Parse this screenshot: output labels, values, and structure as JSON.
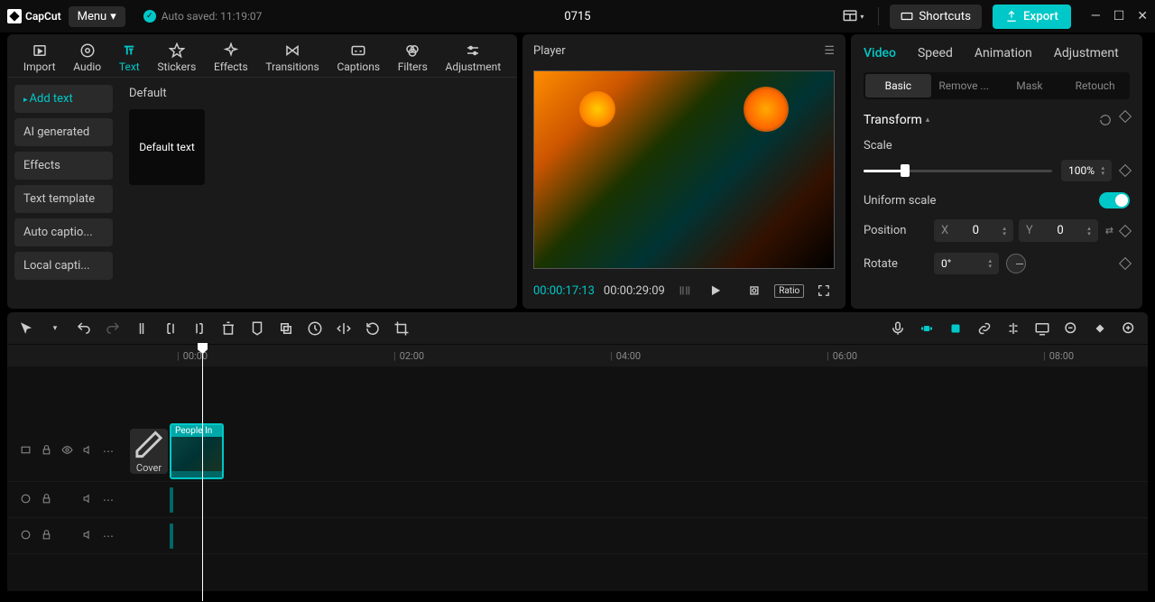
{
  "titlebar": {
    "app_name": "CapCut",
    "menu_label": "Menu",
    "autosave_text": "Auto saved: 11:19:07",
    "project_title": "0715",
    "shortcuts_label": "Shortcuts",
    "export_label": "Export"
  },
  "media_tabs": [
    {
      "id": "import",
      "label": "Import"
    },
    {
      "id": "audio",
      "label": "Audio"
    },
    {
      "id": "text",
      "label": "Text",
      "active": true
    },
    {
      "id": "stickers",
      "label": "Stickers"
    },
    {
      "id": "effects",
      "label": "Effects"
    },
    {
      "id": "transitions",
      "label": "Transitions"
    },
    {
      "id": "captions",
      "label": "Captions"
    },
    {
      "id": "filters",
      "label": "Filters"
    },
    {
      "id": "adjustment",
      "label": "Adjustment"
    }
  ],
  "text_sidebar": [
    {
      "label": "Add text",
      "active": true
    },
    {
      "label": "AI generated"
    },
    {
      "label": "Effects"
    },
    {
      "label": "Text template"
    },
    {
      "label": "Auto captio..."
    },
    {
      "label": "Local capti..."
    }
  ],
  "text_section_title": "Default",
  "text_preset_label": "Default text",
  "player": {
    "title": "Player",
    "current_time": "00:00:17:13",
    "total_time": "00:00:29:09",
    "ratio_label": "Ratio"
  },
  "inspector": {
    "tabs": [
      "Video",
      "Speed",
      "Animation",
      "Adjustment"
    ],
    "active_tab": "Video",
    "subtabs": [
      "Basic",
      "Remove ...",
      "Mask",
      "Retouch"
    ],
    "active_subtab": "Basic",
    "transform_label": "Transform",
    "scale_label": "Scale",
    "scale_value": "100%",
    "uniform_label": "Uniform scale",
    "position_label": "Position",
    "pos_x_label": "X",
    "pos_x_value": "0",
    "pos_y_label": "Y",
    "pos_y_value": "0",
    "rotate_label": "Rotate",
    "rotate_value": "0°"
  },
  "timeline": {
    "ruler": [
      "00:00",
      "02:00",
      "04:00",
      "06:00",
      "08:00"
    ],
    "cover_label": "Cover",
    "clip_label": "People In"
  }
}
